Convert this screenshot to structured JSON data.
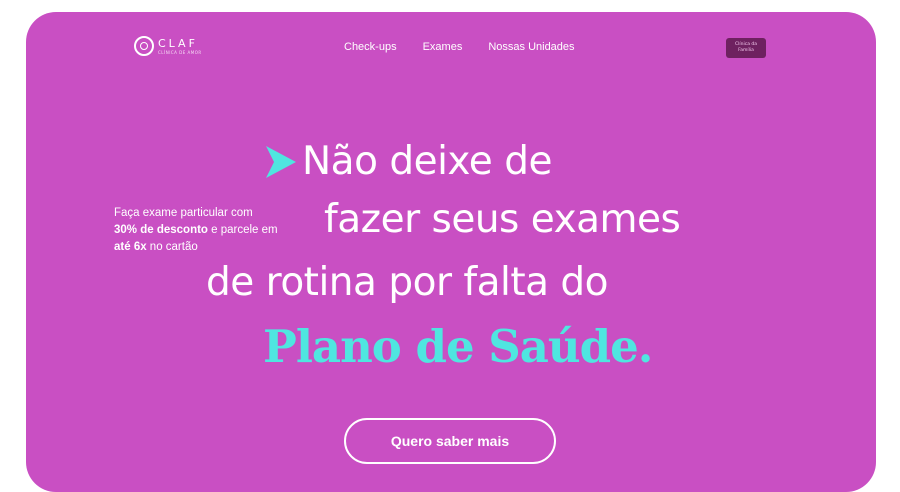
{
  "brand": {
    "name": "CLAF",
    "tagline": "CLÍNICA DE AMOR"
  },
  "nav": {
    "items": [
      "Check-ups",
      "Exames",
      "Nossas Unidades"
    ]
  },
  "header_cta": "Clínica da Família",
  "side_text": {
    "line1": "Faça exame particular com",
    "discount": "30% de desconto",
    "line2_rest": " e parcele em",
    "installments": "até 6x",
    "line3_rest": " no cartão"
  },
  "headline": {
    "line1": "Não deixe de",
    "line2": "fazer seus exames",
    "line3": "de rotina por falta do",
    "line4": "Plano de Saúde."
  },
  "cta_button": "Quero saber mais",
  "colors": {
    "background": "#c94fc3",
    "accent": "#4fe6e0",
    "button_dark": "#6e2160"
  }
}
